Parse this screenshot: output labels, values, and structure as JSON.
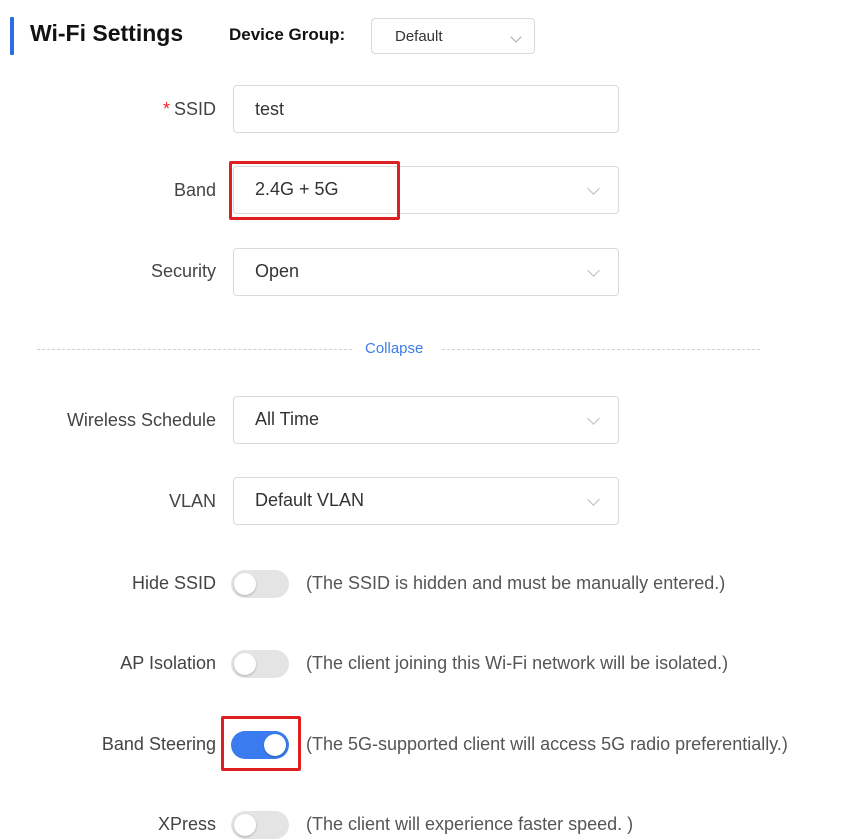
{
  "header": {
    "title": "Wi-Fi Settings",
    "device_group_label": "Device Group:",
    "device_group_value": "Default"
  },
  "form": {
    "ssid": {
      "required_mark": "*",
      "label": "SSID",
      "value": "test"
    },
    "band": {
      "label": "Band",
      "value": "2.4G + 5G"
    },
    "security": {
      "label": "Security",
      "value": "Open"
    },
    "collapse_label": "Collapse",
    "wireless_schedule": {
      "label": "Wireless Schedule",
      "value": "All Time"
    },
    "vlan": {
      "label": "VLAN",
      "value": "Default VLAN"
    },
    "hide_ssid": {
      "label": "Hide SSID",
      "enabled": false,
      "hint": "(The SSID is hidden and must be manually entered.)"
    },
    "ap_isolation": {
      "label": "AP Isolation",
      "enabled": false,
      "hint": "(The client joining this Wi-Fi network will be isolated.)"
    },
    "band_steering": {
      "label": "Band Steering",
      "enabled": true,
      "hint": "(The 5G-supported client will access 5G radio preferentially.)"
    },
    "xpress": {
      "label": "XPress",
      "enabled": false,
      "hint": "(The client will experience faster speed. )"
    }
  },
  "colors": {
    "accent": "#2b6de6",
    "toggle_on": "#3a7bf0",
    "highlight": "#e02020"
  },
  "icons": {
    "select_arrow": "chevron-down-icon"
  }
}
